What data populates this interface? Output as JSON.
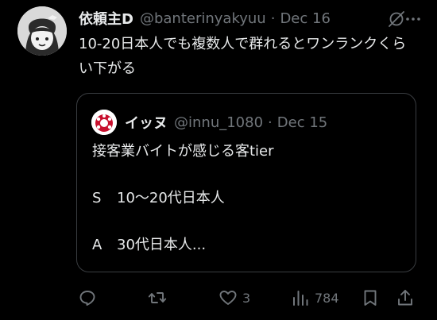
{
  "post": {
    "display_name": "依頼主D",
    "handle": "@banterinyakyuu",
    "separator": "·",
    "date": "Dec 16",
    "text": "10-20日本人でも複数人で群れるとワンランクくらい下がる"
  },
  "quote": {
    "display_name": "イッヌ",
    "handle": "@innu_1080",
    "separator": "·",
    "date": "Dec 15",
    "title": "接客業バイトが感じる客tier",
    "tiers": [
      {
        "grade": "S",
        "text": "10〜20代日本人"
      },
      {
        "grade": "A",
        "text": "30代日本人..."
      }
    ]
  },
  "actions": {
    "reply_count": "",
    "repost_count": "",
    "like_count": "3",
    "views_count": "784"
  },
  "icons": {
    "grok": "grok-icon",
    "more": "more-icon",
    "reply": "reply-icon",
    "repost": "repost-icon",
    "like": "heart-icon",
    "views": "views-icon",
    "bookmark": "bookmark-icon",
    "share": "share-icon"
  },
  "colors": {
    "background": "#000000",
    "text": "#e7e9ea",
    "secondary": "#71767b",
    "border": "#3a3d41"
  }
}
